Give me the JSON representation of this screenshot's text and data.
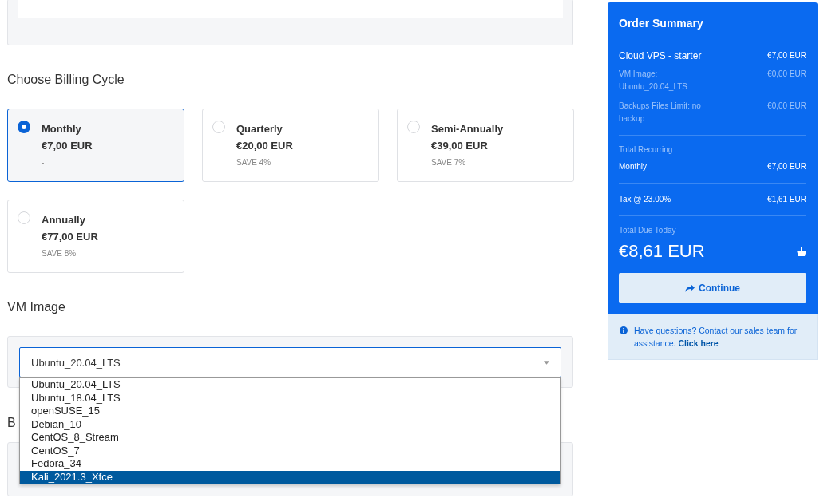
{
  "billing": {
    "title": "Choose Billing Cycle",
    "options": [
      {
        "name": "Monthly",
        "price": "€7,00 EUR",
        "note": "-",
        "selected": true
      },
      {
        "name": "Quarterly",
        "price": "€20,00 EUR",
        "note": "SAVE 4%",
        "selected": false
      },
      {
        "name": "Semi-Annually",
        "price": "€39,00 EUR",
        "note": "SAVE 7%",
        "selected": false
      },
      {
        "name": "Annually",
        "price": "€77,00 EUR",
        "note": "SAVE 8%",
        "selected": false
      }
    ]
  },
  "vm_image": {
    "title": "VM Image",
    "value": "Ubuntu_20.04_LTS",
    "expanded": true,
    "options": [
      {
        "label": "Ubuntu_20.04_LTS",
        "highlighted": false
      },
      {
        "label": "Ubuntu_18.04_LTS",
        "highlighted": false
      },
      {
        "label": "openSUSE_15",
        "highlighted": false
      },
      {
        "label": "Debian_10",
        "highlighted": false
      },
      {
        "label": "CentOS_8_Stream",
        "highlighted": false
      },
      {
        "label": "CentOS_7",
        "highlighted": false
      },
      {
        "label": "Fedora_34",
        "highlighted": false
      },
      {
        "label": "Kali_2021.3_Xfce",
        "highlighted": true
      }
    ]
  },
  "backups": {
    "title": "B"
  },
  "order_summary": {
    "title": "Order Summary",
    "lines": [
      {
        "kind": "product",
        "label": "Cloud VPS - starter",
        "price": "€7,00 EUR"
      },
      {
        "kind": "addon",
        "label": "VM Image: Ubuntu_20.04_LTS",
        "price": "€0,00 EUR"
      },
      {
        "kind": "addon",
        "label": "Backups Files Limit: no backup",
        "price": "€0,00 EUR"
      }
    ],
    "recurring_title": "Total Recurring",
    "recurring": {
      "label": "Monthly",
      "price": "€7,00 EUR"
    },
    "tax": {
      "label": "Tax @ 23.00%",
      "price": "€1,61 EUR"
    },
    "due_title": "Total Due Today",
    "due": "€8,61 EUR",
    "button": "Continue"
  },
  "help": {
    "text": "Have questions? Contact our sales team for assistance.",
    "link": "Click here"
  }
}
